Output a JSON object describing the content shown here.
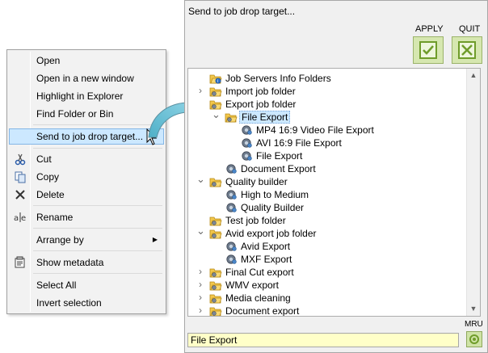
{
  "context_menu": {
    "items": [
      {
        "label": "Open"
      },
      {
        "label": "Open in a new window"
      },
      {
        "label": "Highlight in Explorer"
      },
      {
        "label": "Find Folder or Bin"
      },
      {
        "label": "Send to job drop target...",
        "highlighted": true
      },
      {
        "label": "Cut",
        "icon": "scissors-icon"
      },
      {
        "label": "Copy",
        "icon": "copy-icon"
      },
      {
        "label": "Delete",
        "icon": "delete-x-icon"
      },
      {
        "label": "Rename",
        "icon": "rename-icon"
      },
      {
        "label": "Arrange by",
        "submenu": true
      },
      {
        "label": "Show metadata",
        "icon": "metadata-icon"
      },
      {
        "label": "Select All"
      },
      {
        "label": "Invert selection"
      }
    ]
  },
  "dialog": {
    "title": "Send to job drop target...",
    "apply_label": "APPLY",
    "quit_label": "QUIT",
    "mru_label": "MRU",
    "status_text": "File Export",
    "tree": [
      {
        "label": "Job Servers Info Folders",
        "icon": "info-folder-icon"
      },
      {
        "label": "Import job folder",
        "icon": "job-folder-icon",
        "expander": "collapsed"
      },
      {
        "label": "Export job folder",
        "icon": "job-folder-icon",
        "expander": "none"
      },
      {
        "label": "File Export",
        "icon": "job-folder-icon",
        "expander": "expanded",
        "selected": true
      },
      {
        "label": "MP4 16:9 Video File Export",
        "icon": "gear-job-icon"
      },
      {
        "label": "AVI 16:9 File Export",
        "icon": "gear-job-icon"
      },
      {
        "label": "File Export",
        "icon": "gear-job-icon"
      },
      {
        "label": "Document Export",
        "icon": "gear-job-icon"
      },
      {
        "label": "Quality builder",
        "icon": "job-folder-icon",
        "expander": "expanded"
      },
      {
        "label": "High to Medium",
        "icon": "gear-job-icon"
      },
      {
        "label": "Quality Builder",
        "icon": "gear-job-icon"
      },
      {
        "label": "Test job folder",
        "icon": "job-folder-icon"
      },
      {
        "label": "Avid export job folder",
        "icon": "job-folder-icon",
        "expander": "expanded"
      },
      {
        "label": "Avid Export",
        "icon": "gear-job-icon"
      },
      {
        "label": "MXF Export",
        "icon": "gear-job-icon"
      },
      {
        "label": "Final Cut export",
        "icon": "job-folder-icon",
        "expander": "collapsed"
      },
      {
        "label": "WMV export",
        "icon": "job-folder-icon",
        "expander": "collapsed"
      },
      {
        "label": "Media cleaning",
        "icon": "job-folder-icon",
        "expander": "collapsed"
      },
      {
        "label": "Document export",
        "icon": "job-folder-icon",
        "expander": "collapsed"
      }
    ]
  }
}
